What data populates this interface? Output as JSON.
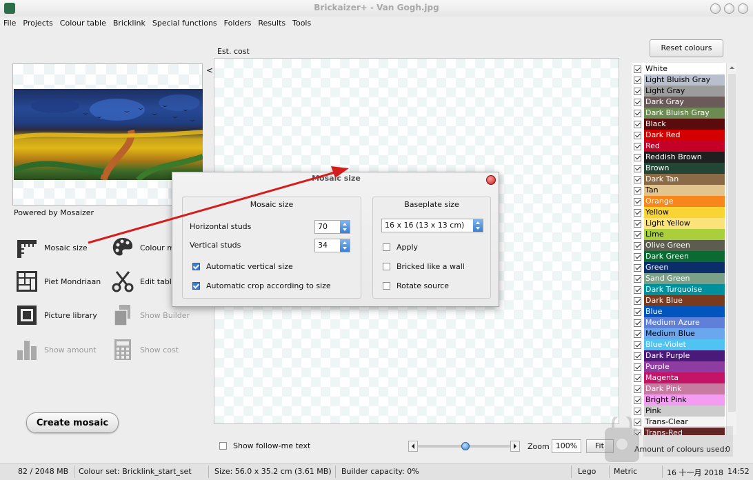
{
  "window": {
    "title": "Brickaizer+   - Van Gogh.jpg"
  },
  "menu": [
    "File",
    "Projects",
    "Colour table",
    "Bricklink",
    "Special functions",
    "Folders",
    "Results",
    "Tools"
  ],
  "left": {
    "collapse": "<",
    "powered": "Powered by Mosaizer",
    "tools": {
      "mosaic_size": "Mosaic size",
      "colour_m": "Colour m",
      "piet": "Piet Mondriaan",
      "edit_table": "Edit table",
      "picture_library": "Picture library",
      "show_builder": "Show Builder",
      "show_amount": "Show amount",
      "show_cost": "Show cost"
    },
    "create": "Create mosaic"
  },
  "center": {
    "est_cost": "Est. cost",
    "followme": "Show follow-me text",
    "zoom_label": "Zoom",
    "zoom_value": "100%",
    "fit": "Fit",
    "slider_fraction": 0.52
  },
  "right": {
    "reset": "Reset colours",
    "amount_label": "Amount of colours used:",
    "amount_value": "0",
    "colours": [
      {
        "name": "White",
        "color": "#ffffff",
        "text": "#000"
      },
      {
        "name": "Light Bluish Gray",
        "color": "#b9bfcc",
        "text": "#000"
      },
      {
        "name": "Light Gray",
        "color": "#9c9c9c",
        "text": "#000"
      },
      {
        "name": "Dark Gray",
        "color": "#6b5a5a",
        "text": "#fff"
      },
      {
        "name": "Dark Bluish Gray",
        "color": "#6c8a52",
        "text": "#fff"
      },
      {
        "name": "Black",
        "color": "#5a0c0c",
        "text": "#fff"
      },
      {
        "name": "Dark Red",
        "color": "#d40000",
        "text": "#fff"
      },
      {
        "name": "Red",
        "color": "#c40026",
        "text": "#fff"
      },
      {
        "name": "Reddish Brown",
        "color": "#1f1f1f",
        "text": "#fff"
      },
      {
        "name": "Brown",
        "color": "#234536",
        "text": "#fff"
      },
      {
        "name": "Dark Tan",
        "color": "#8a6a47",
        "text": "#fff"
      },
      {
        "name": "Tan",
        "color": "#e2c48f",
        "text": "#000"
      },
      {
        "name": "Orange",
        "color": "#f7861d",
        "text": "#fff"
      },
      {
        "name": "Yellow",
        "color": "#f8d435",
        "text": "#000"
      },
      {
        "name": "Light Yellow",
        "color": "#fbe37a",
        "text": "#000"
      },
      {
        "name": "Lime",
        "color": "#a9cf3a",
        "text": "#000"
      },
      {
        "name": "Olive Green",
        "color": "#5d5d4f",
        "text": "#fff"
      },
      {
        "name": "Dark Green",
        "color": "#0b6a31",
        "text": "#fff"
      },
      {
        "name": "Green",
        "color": "#0b2d6a",
        "text": "#fff"
      },
      {
        "name": "Sand Green",
        "color": "#7aa08a",
        "text": "#fff"
      },
      {
        "name": "Dark Turquoise",
        "color": "#008f9b",
        "text": "#fff"
      },
      {
        "name": "Dark Blue",
        "color": "#7a3a1d",
        "text": "#fff"
      },
      {
        "name": "Blue",
        "color": "#0055bf",
        "text": "#fff"
      },
      {
        "name": "Medium Azure",
        "color": "#5f7fd8",
        "text": "#fff"
      },
      {
        "name": "Medium Blue",
        "color": "#6aa7ee",
        "text": "#000"
      },
      {
        "name": "Blue-Violet",
        "color": "#4fc3f2",
        "text": "#fff"
      },
      {
        "name": "Dark Purple",
        "color": "#4a1a7a",
        "text": "#fff"
      },
      {
        "name": "Purple",
        "color": "#8e3ca0",
        "text": "#fff"
      },
      {
        "name": "Magenta",
        "color": "#c41466",
        "text": "#fff"
      },
      {
        "name": "Dark Pink",
        "color": "#c87aa0",
        "text": "#fff"
      },
      {
        "name": "Bright Pink",
        "color": "#f49cf2",
        "text": "#000"
      },
      {
        "name": "Pink",
        "color": "#cccccc",
        "text": "#000"
      },
      {
        "name": "Trans-Clear",
        "color": "#f4f4f4",
        "text": "#000"
      },
      {
        "name": "Trans-Red",
        "color": "#5a1010",
        "text": "#fff"
      }
    ]
  },
  "dialog": {
    "title": "Mosaic size",
    "mosaic_group": "Mosaic size",
    "horizontal_label": "Horizontal studs",
    "horizontal_value": "70",
    "vertical_label": "Vertical studs",
    "vertical_value": "34",
    "auto_vertical": "Automatic vertical size",
    "auto_crop": "Automatic crop according to size",
    "baseplate_group": "Baseplate size",
    "baseplate_value": "16 x 16 (13 x 13 cm)",
    "apply": "Apply",
    "bricked": "Bricked like a wall",
    "rotate": "Rotate source"
  },
  "status": {
    "memory": "82 / 2048 MB",
    "colour_set": "Colour set: Bricklink_start_set",
    "size": "Size: 56.0 x 35.2 cm (3.61 MB)",
    "builder": "Builder capacity: 0%",
    "brand": "Lego",
    "unit": "Metric",
    "date": "16 十一月 2018",
    "time": "14:52"
  },
  "colors": {
    "accent": "#3d7fd0",
    "arrow": "#d41e1e"
  }
}
